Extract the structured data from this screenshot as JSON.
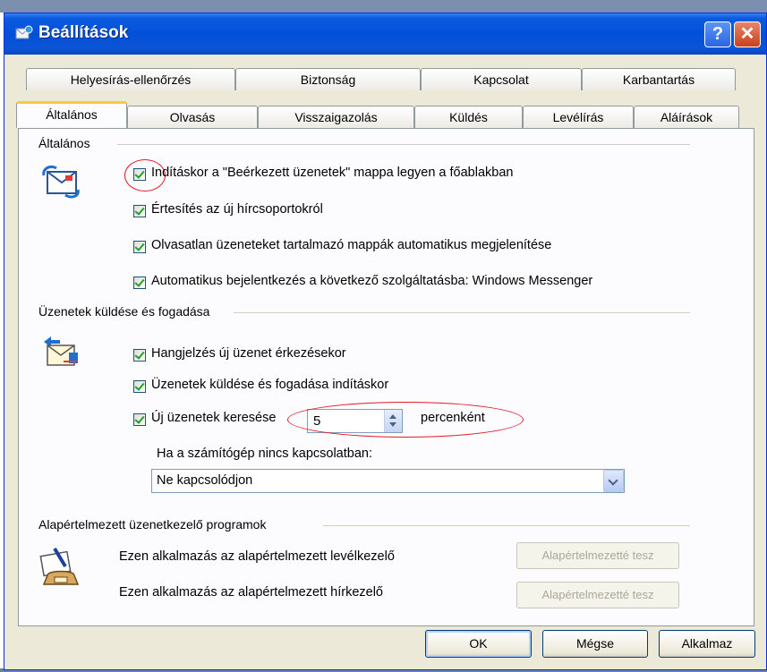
{
  "window": {
    "title": "Beállítások",
    "help_label": "?",
    "close_label": "✕"
  },
  "tabs": {
    "row1": [
      "Helyesírás-ellenőrzés",
      "Biztonság",
      "Kapcsolat",
      "Karbantartás"
    ],
    "row2": [
      "Általános",
      "Olvasás",
      "Visszaigazolás",
      "Küldés",
      "Levélírás",
      "Aláírások"
    ],
    "active": "Általános"
  },
  "general": {
    "label": "Általános",
    "icon": "mail-envelope-icon",
    "options": [
      {
        "label": "Indításkor a \"Beérkezett üzenetek\" mappa legyen a főablakban",
        "checked": true
      },
      {
        "label": "Értesítés az új hírcsoportokról",
        "checked": true
      },
      {
        "label": "Olvasatlan üzeneteket tartalmazó mappák automatikus megjelenítése",
        "checked": true
      },
      {
        "label": "Automatikus bejelentkezés a következő szolgáltatásba: Windows Messenger",
        "checked": true
      }
    ]
  },
  "send_receive": {
    "label": "Üzenetek küldése és fogadása",
    "icon": "send-receive-icon",
    "options": [
      {
        "label": "Hangjelzés új üzenet érkezésekor",
        "checked": true
      },
      {
        "label": "Üzenetek küldése és fogadása indításkor",
        "checked": true
      },
      {
        "label": "Új üzenetek keresése",
        "checked": true
      }
    ],
    "interval_value": "5",
    "interval_unit": "percenként",
    "offline_label": "Ha a számítógép nincs kapcsolatban:",
    "offline_selected": "Ne kapcsolódjon"
  },
  "default_programs": {
    "label": "Alapértelmezett üzenetkezelő programok",
    "icon": "mail-phone-icon",
    "mail_text": "Ezen alkalmazás az alapértelmezett levélkezelő",
    "news_text": "Ezen alkalmazás az alapértelmezett hírkezelő",
    "set_default_label": "Alapértelmezetté tesz"
  },
  "footer": {
    "ok": "OK",
    "cancel": "Mégse",
    "apply": "Alkalmaz"
  },
  "colors": {
    "titlebar": "#0350d8",
    "annotation": "#e4172a",
    "active_tab_accent": "#ffc73c"
  }
}
